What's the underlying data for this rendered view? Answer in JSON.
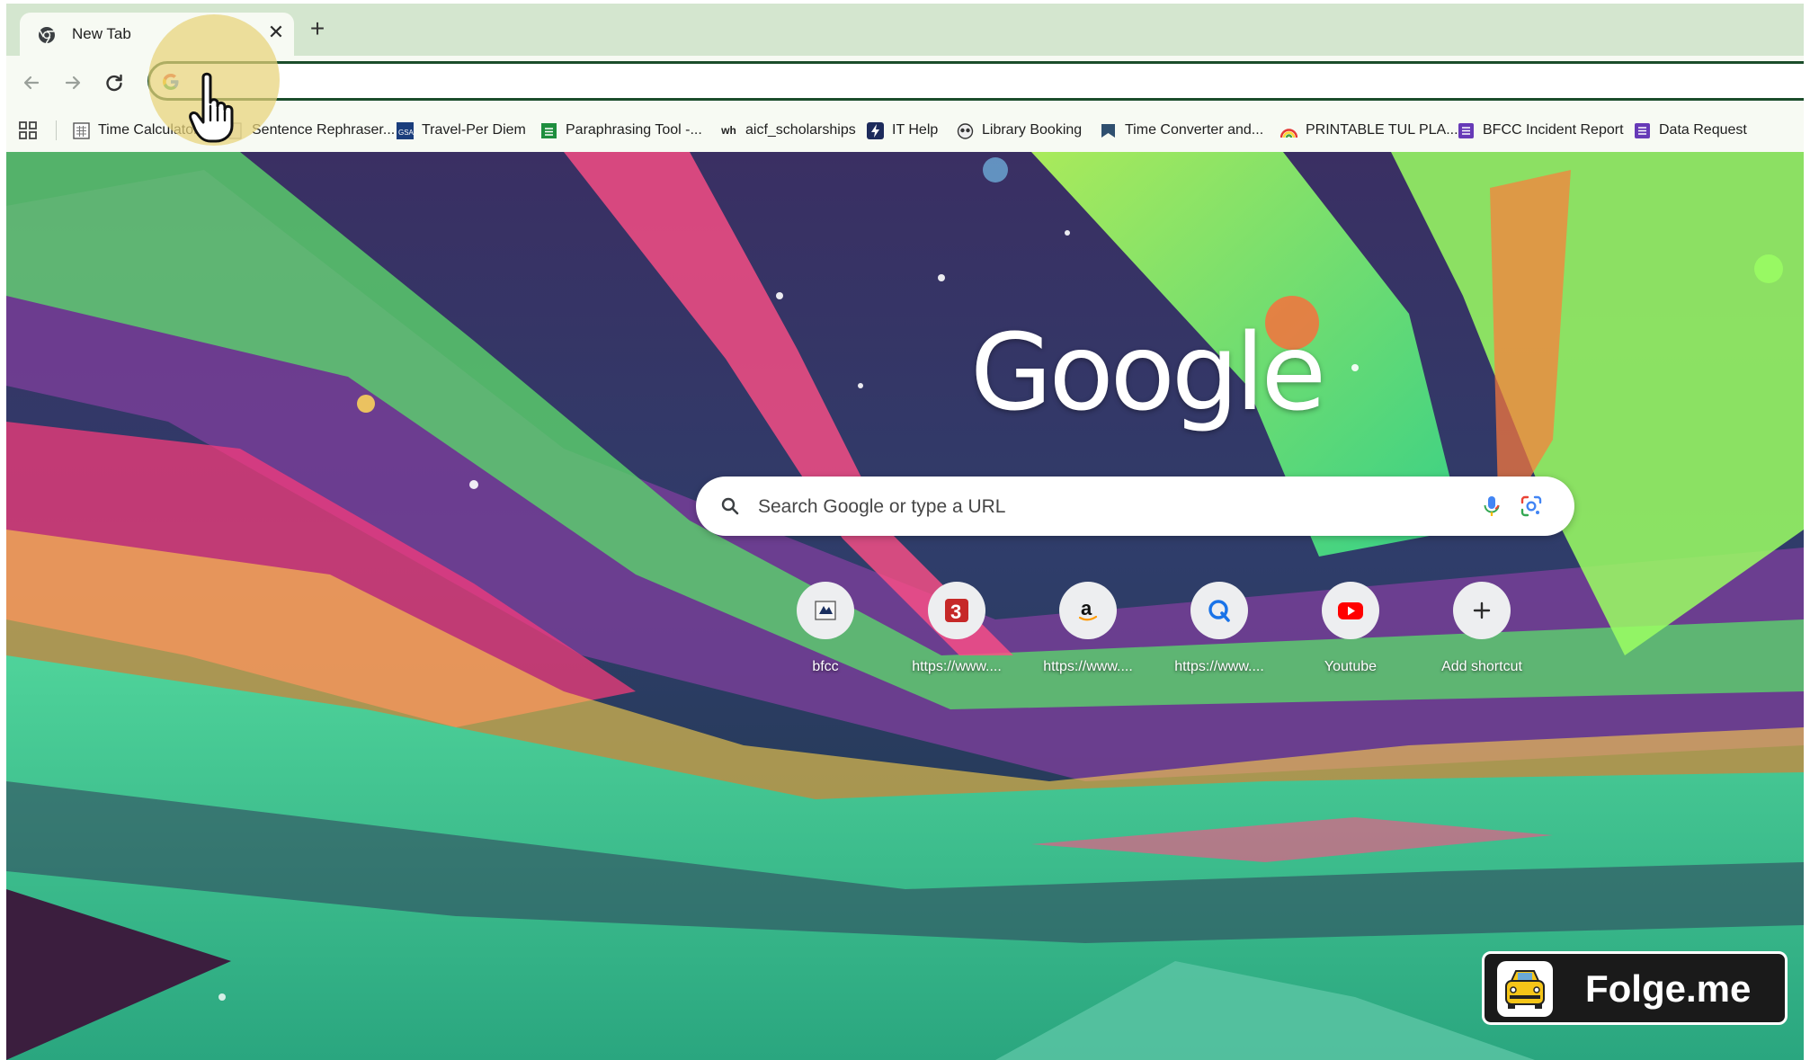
{
  "browser": {
    "tab": {
      "title": "New Tab",
      "close_symbol": "✕"
    },
    "new_tab_symbol": "+",
    "omnibox": {
      "value": "",
      "placeholder": ""
    },
    "colors": {
      "toolbar": "#f7faf3",
      "tabstrip": "#d4e6cf",
      "omnibox_border": "#1b4d2b"
    }
  },
  "bookmarks": [
    {
      "label": "Time Calculator",
      "icon": "calculator-icon"
    },
    {
      "label": "Sentence Rephraser...",
      "icon": "document-icon"
    },
    {
      "label": "Travel-Per Diem",
      "icon": "gsa-icon"
    },
    {
      "label": "Paraphrasing Tool -...",
      "icon": "sheet-icon"
    },
    {
      "label": "aicf_scholarships",
      "icon": "wh-icon"
    },
    {
      "label": "IT Help",
      "icon": "lightning-icon"
    },
    {
      "label": "Library Booking",
      "icon": "owl-icon"
    },
    {
      "label": "Time Converter and...",
      "icon": "clock-icon"
    },
    {
      "label": "PRINTABLE TUL PLA...",
      "icon": "rainbow-icon"
    },
    {
      "label": "BFCC Incident Report",
      "icon": "form-icon"
    },
    {
      "label": "Data Request",
      "icon": "form-icon"
    }
  ],
  "newtab": {
    "logo": "Google",
    "search": {
      "placeholder": "Search Google or type a URL"
    },
    "shortcuts": [
      {
        "label": "bfcc",
        "icon": "bfcc-icon"
      },
      {
        "label": "https://www....",
        "icon": "number-3-icon"
      },
      {
        "label": "https://www....",
        "icon": "amazon-icon"
      },
      {
        "label": "https://www....",
        "icon": "q-icon"
      },
      {
        "label": "Youtube",
        "icon": "youtube-icon"
      },
      {
        "label": "Add shortcut",
        "icon": "plus-icon"
      }
    ]
  },
  "watermark": {
    "text": "Folge.me"
  }
}
